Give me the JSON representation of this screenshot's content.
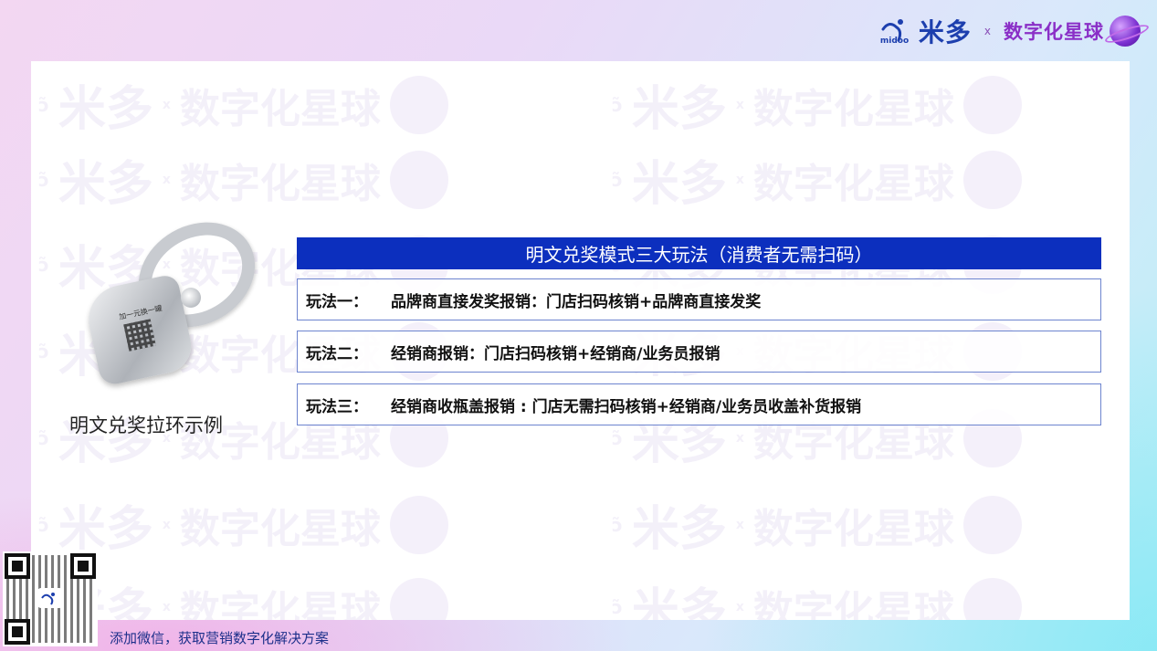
{
  "brand": {
    "name_cn": "米多",
    "name_en": "midoo",
    "separator": "x",
    "partner": "数字化星球"
  },
  "illustration": {
    "pull_text": "加一元换一罐",
    "caption": "明文兑奖拉环示例"
  },
  "main": {
    "title": "明文兑奖模式三大玩法（消费者无需扫码）",
    "rows": [
      {
        "label": "玩法一：",
        "text": "品牌商直接发奖报销：门店扫码核销+品牌商直接发奖"
      },
      {
        "label": "玩法二：",
        "text": "经销商报销：门店扫码核销+经销商/业务员报销"
      },
      {
        "label": "玩法三：",
        "text": "经销商收瓶盖报销 : 门店无需扫码核销+经销商/业务员收盖补货报销"
      }
    ]
  },
  "footer": {
    "text": "添加微信，获取营销数字化解决方案"
  },
  "colors": {
    "title_bar": "#0c2fbe",
    "brand_blue": "#1d3fae",
    "brand_purple": "#8a2fc7"
  }
}
